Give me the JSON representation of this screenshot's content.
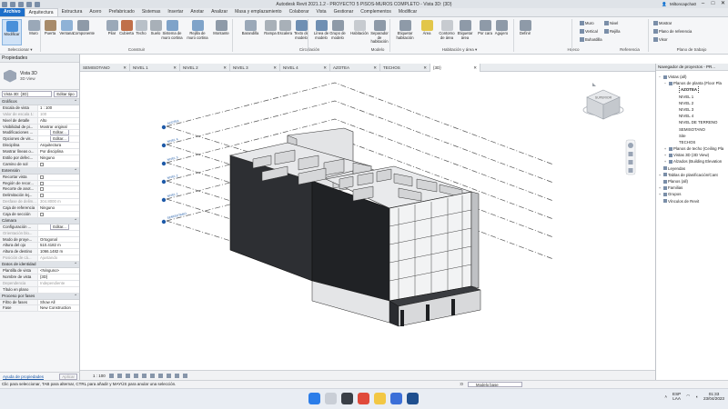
{
  "titlebar": {
    "title": "Autodesk Revit 2021.1.2 - PROYECTO 5 PISOS-MUROS COMPLETO - Vista 3D: {3D}",
    "user": "Miltoncapcha0"
  },
  "ribbon_tabs": [
    "Archivo",
    "Arquitectura",
    "Estructura",
    "Acero",
    "Prefabricado",
    "Sistemas",
    "Insertar",
    "Anotar",
    "Analizar",
    "Masa y emplazamiento",
    "Colaborar",
    "Vista",
    "Gestionar",
    "Complementos",
    "Modificar"
  ],
  "active_tab": "Arquitectura",
  "ribbon": {
    "buttons": [
      {
        "label": "Modificar",
        "color": "#4a90d9"
      },
      {
        "label": "Muro",
        "color": "#9aa8b8"
      },
      {
        "label": "Puerta",
        "color": "#a88b6a"
      },
      {
        "label": "Ventana",
        "color": "#8fb2d6"
      },
      {
        "label": "Componente",
        "color": "#8e9aa8"
      },
      {
        "label": "Pilar",
        "color": "#9aa8b8"
      },
      {
        "label": "Cubierta",
        "color": "#c0704a"
      },
      {
        "label": "Techo",
        "color": "#b8c0c8"
      },
      {
        "label": "Suelo",
        "color": "#a8b0b8"
      },
      {
        "label": "Sistema de muro cortina",
        "color": "#7fa3c9"
      },
      {
        "label": "Rejilla de muro cortina",
        "color": "#7fa3c9"
      },
      {
        "label": "Montante",
        "color": "#8e9aa8"
      },
      {
        "label": "Barandilla",
        "color": "#9aa8b8"
      },
      {
        "label": "Rampa",
        "color": "#a8b0b8"
      },
      {
        "label": "Escalera",
        "color": "#a8b0b8"
      },
      {
        "label": "Texto de modelo",
        "color": "#6f8fb3"
      },
      {
        "label": "Línea de modelo",
        "color": "#6f8fb3"
      },
      {
        "label": "Grupo de modelo",
        "color": "#8e9aa8"
      },
      {
        "label": "Habitación",
        "color": "#c7cbd0"
      },
      {
        "label": "Separador de habitación",
        "color": "#8e9aa8"
      },
      {
        "label": "Etiquetar habitación",
        "color": "#8e9aa8"
      },
      {
        "label": "Área",
        "color": "#e2c64a"
      },
      {
        "label": "Contorno de área",
        "color": "#c7cbd0"
      },
      {
        "label": "Etiquetar área",
        "color": "#8e9aa8"
      },
      {
        "label": "Por cara",
        "color": "#8e9aa8"
      },
      {
        "label": "Agujero",
        "color": "#8e9aa8"
      },
      {
        "label": "Definir",
        "color": "#8e9aa8"
      }
    ],
    "small_items": [
      "Muro",
      "Vertical",
      "Buhardilla",
      "Nivel",
      "Rejilla",
      "Mostrar",
      "Plano de referencia",
      "Visor"
    ],
    "groups": [
      "Seleccionar ▾",
      "Construir",
      "Circulación",
      "Modelo",
      "Habitación y área ▾",
      "Hueco",
      "Referencia",
      "Plano de trabajo"
    ]
  },
  "properties": {
    "header": "Propiedades",
    "type_name": "Vista 3D",
    "type_sub": "3D View",
    "selector": "Vista 3D: {3D}",
    "edit_type": "Editar tipo",
    "sections": [
      {
        "title": "Gráficos",
        "rows": [
          {
            "k": "Escala de vista",
            "v": "1 : 100"
          },
          {
            "k": "Valor de escala 1:",
            "v": "100",
            "dim": true
          },
          {
            "k": "Nivel de detalle",
            "v": "Alto"
          },
          {
            "k": "Visibilidad de pi...",
            "v": "Mostrar original"
          },
          {
            "k": "Modificaciones ...",
            "v": "Editar..."
          },
          {
            "k": "Opciones de vis...",
            "v": "Editar..."
          },
          {
            "k": "Disciplina",
            "v": "Arquitectura"
          },
          {
            "k": "Mostrar líneas o...",
            "v": "Por disciplina"
          },
          {
            "k": "Estilo por defec...",
            "v": "Ninguno"
          },
          {
            "k": "Camino de sol",
            "v": "☐"
          }
        ]
      },
      {
        "title": "Extensión",
        "rows": [
          {
            "k": "Recortar vista",
            "v": "☐"
          },
          {
            "k": "Región de recor...",
            "v": "☐"
          },
          {
            "k": "Recorte de anot...",
            "v": "☐"
          },
          {
            "k": "Delimitación lej...",
            "v": "☐"
          },
          {
            "k": "Desfase de delim...",
            "v": "304.8000 m",
            "dim": true
          },
          {
            "k": "Caja de referencia",
            "v": "Ninguno"
          },
          {
            "k": "Caja de sección",
            "v": "☐"
          }
        ]
      },
      {
        "title": "Cámara",
        "rows": [
          {
            "k": "Configuración ...",
            "v": "Editar..."
          },
          {
            "k": "Orientación blo...",
            "v": "",
            "dim": true
          },
          {
            "k": "Modo de proye...",
            "v": "Ortogonal"
          },
          {
            "k": "Altura del ojo",
            "v": "510.4182 m"
          },
          {
            "k": "Altura de destino",
            "v": "1066.1482 m"
          },
          {
            "k": "Posición de cá...",
            "v": "Ajustando",
            "dim": true
          }
        ]
      },
      {
        "title": "Datos de identidad",
        "rows": [
          {
            "k": "Plantilla de vista",
            "v": "<Ninguno>"
          },
          {
            "k": "Nombre de vista",
            "v": "{3D}"
          },
          {
            "k": "Dependencia",
            "v": "Independiente",
            "dim": true
          },
          {
            "k": "Título en plano",
            "v": ""
          }
        ]
      },
      {
        "title": "Proceso por fases",
        "rows": [
          {
            "k": "Filtro de fases",
            "v": "Show All"
          },
          {
            "k": "Fase",
            "v": "New Construction"
          }
        ]
      }
    ],
    "help_link": "Ayuda de propiedades",
    "apply": "Aplicar"
  },
  "view_tabs": [
    "SEMISOTANO",
    "NIVEL 1",
    "NIVEL 2",
    "NIVEL 3",
    "NIVEL 4",
    "AZOTEA",
    "TECHOS",
    "{3D}"
  ],
  "active_view": "{3D}",
  "level_tags": [
    "AZOTEA",
    "NIVEL 4",
    "NIVEL 3",
    "NIVEL 2",
    "NIVEL 1",
    "SEMISOTANO"
  ],
  "viewcube_label": "SUPERIOR",
  "viewbar": {
    "scale": "1 : 100"
  },
  "browser": {
    "header": "Navegador de proyectos - PR...",
    "nodes": [
      {
        "d": 0,
        "t": "−",
        "label": "Vistas (all)"
      },
      {
        "d": 1,
        "t": "−",
        "label": "Planos de planta (Floor Pla"
      },
      {
        "d": 2,
        "t": "",
        "label": "AZOTEA",
        "sel": true
      },
      {
        "d": 2,
        "t": "",
        "label": "NIVEL 1"
      },
      {
        "d": 2,
        "t": "",
        "label": "NIVEL 2"
      },
      {
        "d": 2,
        "t": "",
        "label": "NIVEL 3"
      },
      {
        "d": 2,
        "t": "",
        "label": "NIVEL 4"
      },
      {
        "d": 2,
        "t": "",
        "label": "NIVEL DE TERRENO"
      },
      {
        "d": 2,
        "t": "",
        "label": "SEMISOTANO"
      },
      {
        "d": 2,
        "t": "",
        "label": "Site"
      },
      {
        "d": 2,
        "t": "",
        "label": "TECHOS"
      },
      {
        "d": 1,
        "t": "+",
        "label": "Planos de techo (Ceiling Pla"
      },
      {
        "d": 1,
        "t": "+",
        "label": "Vistas 3D (3D View)"
      },
      {
        "d": 1,
        "t": "+",
        "label": "Alzados (Building Elevation"
      },
      {
        "d": 0,
        "t": "",
        "label": "Leyendas"
      },
      {
        "d": 0,
        "t": "+",
        "label": "Tablas de planificación/Cant"
      },
      {
        "d": 0,
        "t": "",
        "label": "Planos (all)"
      },
      {
        "d": 0,
        "t": "+",
        "label": "Familias"
      },
      {
        "d": 0,
        "t": "+",
        "label": "Grupos"
      },
      {
        "d": 0,
        "t": "",
        "label": "Vínculos de Revit"
      }
    ]
  },
  "status": {
    "text": "Clic para seleccionar, TAB para alternar, CTRL para añadir y MAYÚS para anular una selección.",
    "zero": ":0",
    "model": "Modelo base"
  },
  "taskbar": {
    "apps": [
      {
        "name": "windows",
        "color": "#2b7de9"
      },
      {
        "name": "search",
        "color": "#c9ced6"
      },
      {
        "name": "task-view",
        "color": "#3a3f47"
      },
      {
        "name": "chrome",
        "color": "#e04a3b"
      },
      {
        "name": "explorer",
        "color": "#f2c744"
      },
      {
        "name": "store",
        "color": "#3b6fd8"
      },
      {
        "name": "revit",
        "color": "#1f4f8f"
      }
    ],
    "lang": "ESP",
    "lang_sub": "LAA",
    "time": "01:33",
    "date": "23/04/2023"
  }
}
